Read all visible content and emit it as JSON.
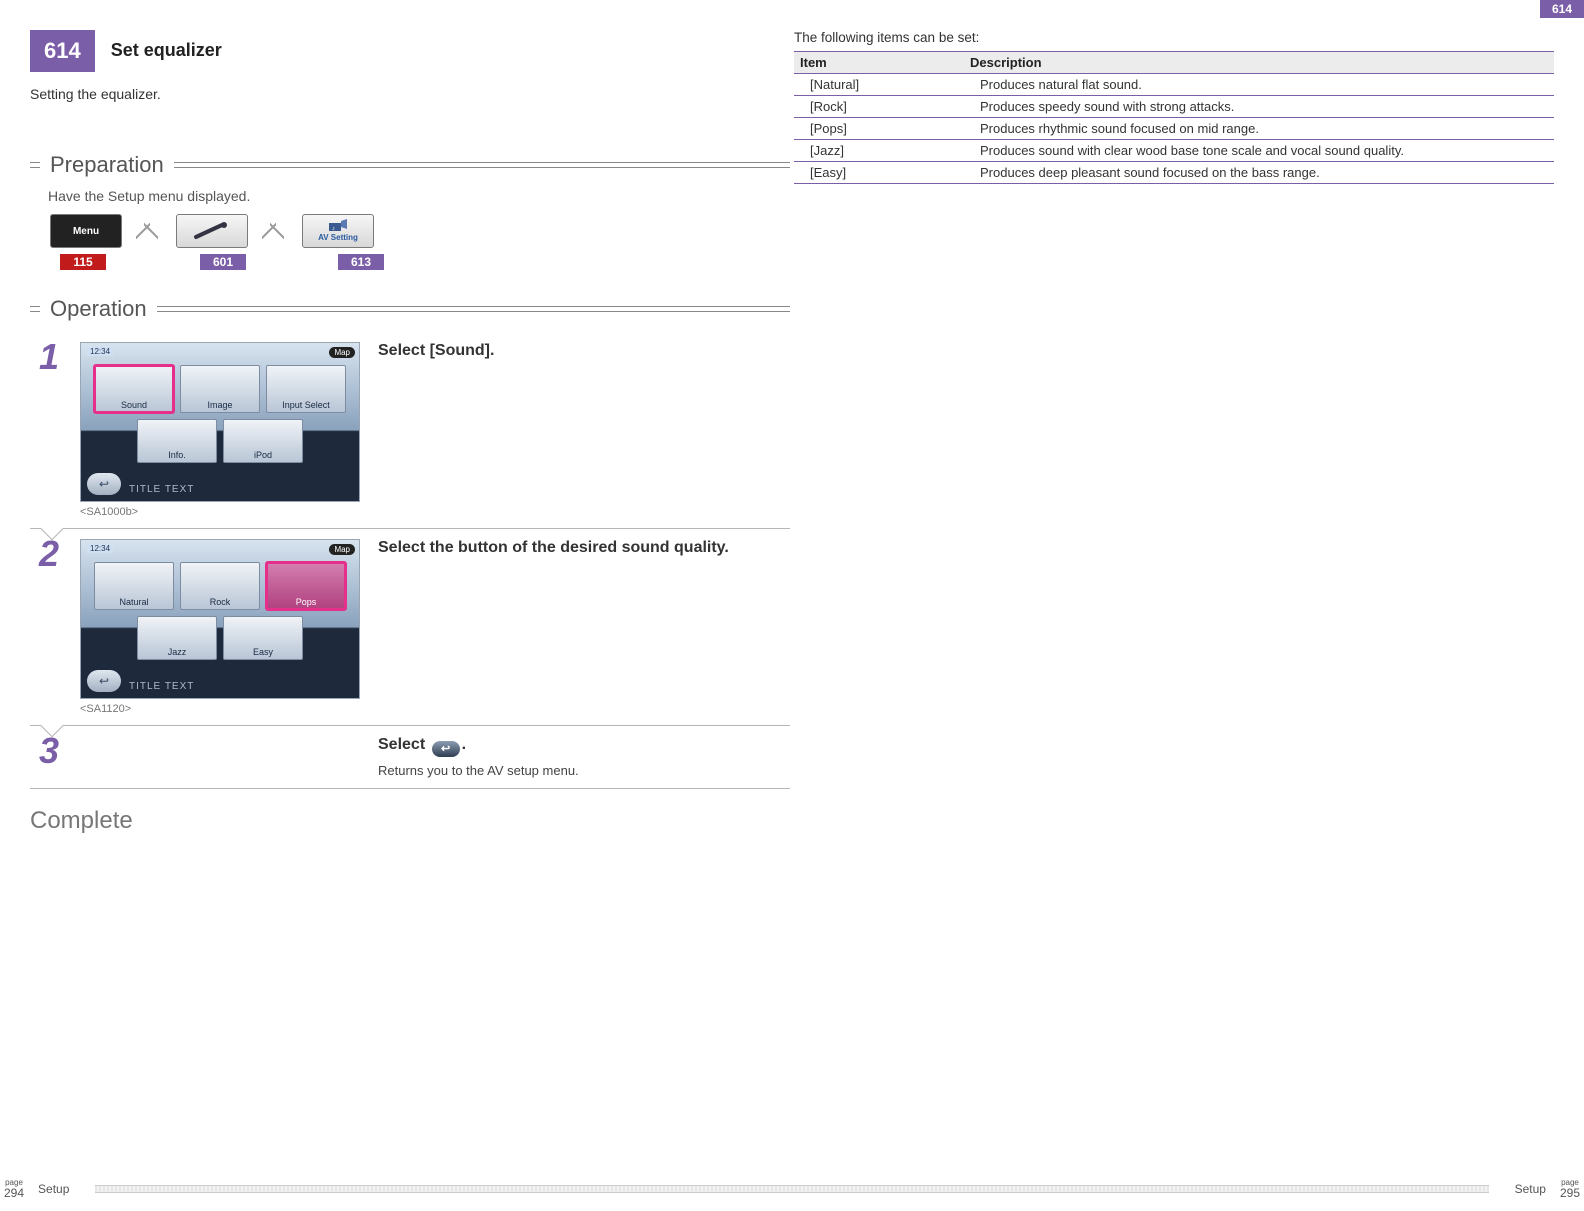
{
  "section_id": "614",
  "page_title": "Set equalizer",
  "intro": "Setting the equalizer.",
  "preparation": {
    "heading": "Preparation",
    "text": "Have the Setup menu displayed.",
    "icons": {
      "menu_label": "Menu",
      "av_label": "AV Setting"
    },
    "refs": [
      "115",
      "601",
      "613"
    ]
  },
  "operation": {
    "heading": "Operation",
    "steps": [
      {
        "num": "1",
        "instruction_bold": "Select [Sound].",
        "instruction_rest": "",
        "screenshot": {
          "time": "12:34",
          "map": "Map",
          "tiles_row1": [
            "Sound",
            "Image",
            "Input Select"
          ],
          "tiles_row2": [
            "Info.",
            "iPod"
          ],
          "selected": "Sound",
          "title_text": "TITLE TEXT"
        },
        "img_id": "<SA1000b>"
      },
      {
        "num": "2",
        "instruction_bold": "Select the button of the desired sound quality.",
        "instruction_rest": "",
        "screenshot": {
          "time": "12:34",
          "map": "Map",
          "tiles_row1": [
            "Natural",
            "Rock",
            "Pops"
          ],
          "tiles_row2": [
            "Jazz",
            "Easy"
          ],
          "selected": "Pops",
          "title_text": "TITLE TEXT"
        },
        "img_id": "<SA1120>"
      },
      {
        "num": "3",
        "instruction_bold_pre": "Select ",
        "instruction_bold_post": ".",
        "return_glyph": "↩",
        "sub": "Returns you to the AV setup menu."
      }
    ]
  },
  "complete": "Complete",
  "table": {
    "intro": "The following items can be set:",
    "headers": [
      "Item",
      "Description"
    ],
    "rows": [
      [
        "[Natural]",
        "Produces natural flat sound."
      ],
      [
        "[Rock]",
        "Produces speedy sound with strong attacks."
      ],
      [
        "[Pops]",
        "Produces rhythmic sound focused on mid range."
      ],
      [
        "[Jazz]",
        "Produces sound with clear wood base tone scale and vocal sound quality."
      ],
      [
        "[Easy]",
        "Produces deep pleasant sound focused on the bass range."
      ]
    ]
  },
  "footer": {
    "section": "Setup",
    "page_label": "page",
    "left_num": "294",
    "right_num": "295"
  }
}
